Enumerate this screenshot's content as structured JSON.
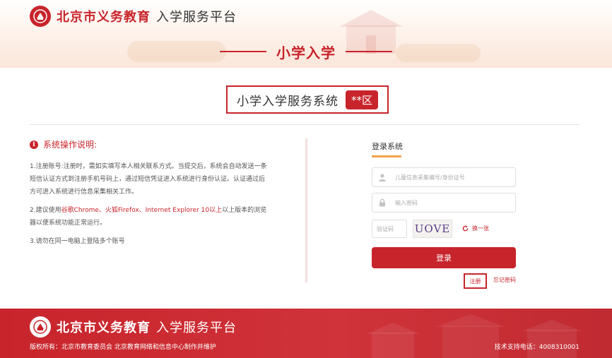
{
  "brand": {
    "name_bold": "北京市义务教育",
    "name_light": "入学服务平台"
  },
  "page_title": "小学入学",
  "system": {
    "name": "小学入学服务系统",
    "district": "**区"
  },
  "instructions": {
    "title": "系统操作说明:",
    "p1": "1.注册账号:注册时，需如实填写本人相关联系方式。当提交后，系统会自动发送一条短信认证方式到注册手机号码上，通过短信凭证进入系统进行身份认证。认证通过后方可进入系统进行信息采集相关工作。",
    "p2_prefix": "2.建议使用",
    "p2_red": "谷歌Chrome、火狐Firefox、Internet Explorer 10以上",
    "p2_suffix": "以上版本的浏览器以便系统功能正常运行。",
    "p3": "3.请勿在同一电脑上登陆多个账号"
  },
  "login": {
    "tab": "登录系统",
    "id_placeholder": "儿童信息采集编号/身份证号",
    "password_placeholder": "输入密码",
    "captcha_placeholder": "验证码",
    "captcha_text": "UOVE",
    "refresh_label": "换一张",
    "submit": "登录",
    "register": "注册",
    "forgot": "忘记密码"
  },
  "footer": {
    "brand_bold": "北京市义务教育",
    "brand_light": "入学服务平台",
    "copyright": "版权所有：北京市教育委员会 北京教育网络和信息中心制作并维护",
    "support": "技术支持电话：4008310001"
  },
  "colors": {
    "primary": "#c8242b",
    "accent": "#f0a24b"
  }
}
